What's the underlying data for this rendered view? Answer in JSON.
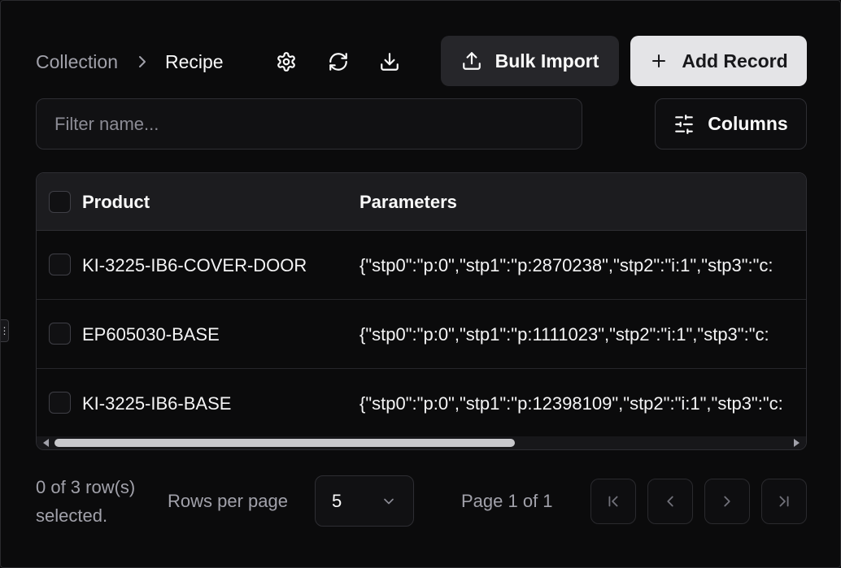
{
  "breadcrumb": {
    "parent": "Collection",
    "current": "Recipe"
  },
  "toolbar": {
    "settings_icon": "gear-icon",
    "refresh_icon": "refresh-icon",
    "download_icon": "download-icon",
    "bulk_import_label": "Bulk Import",
    "add_record_label": "Add Record",
    "columns_label": "Columns"
  },
  "filter": {
    "placeholder": "Filter name...",
    "value": ""
  },
  "table": {
    "columns": [
      "Product",
      "Parameters"
    ],
    "rows": [
      {
        "product": "KI-3225-IB6-COVER-DOOR",
        "parameters": "{\"stp0\":\"p:0\",\"stp1\":\"p:2870238\",\"stp2\":\"i:1\",\"stp3\":\"c:",
        "selected": false
      },
      {
        "product": "EP605030-BASE",
        "parameters": "{\"stp0\":\"p:0\",\"stp1\":\"p:1111023\",\"stp2\":\"i:1\",\"stp3\":\"c:",
        "selected": false
      },
      {
        "product": "KI-3225-IB6-BASE",
        "parameters": "{\"stp0\":\"p:0\",\"stp1\":\"p:12398109\",\"stp2\":\"i:1\",\"stp3\":\"c:",
        "selected": false
      }
    ],
    "horizontal_scroll_fraction": 0.6
  },
  "footer": {
    "selection_line1": "0 of 3 row(s)",
    "selection_line2": "selected.",
    "rows_per_page_label": "Rows per page",
    "rows_per_page_value": "5",
    "page_info": "Page 1 of 1"
  },
  "colors": {
    "background": "#0b0b0c",
    "surface": "#1c1c1f",
    "primary_button": "#e4e4e7",
    "border": "#2e2e33"
  }
}
